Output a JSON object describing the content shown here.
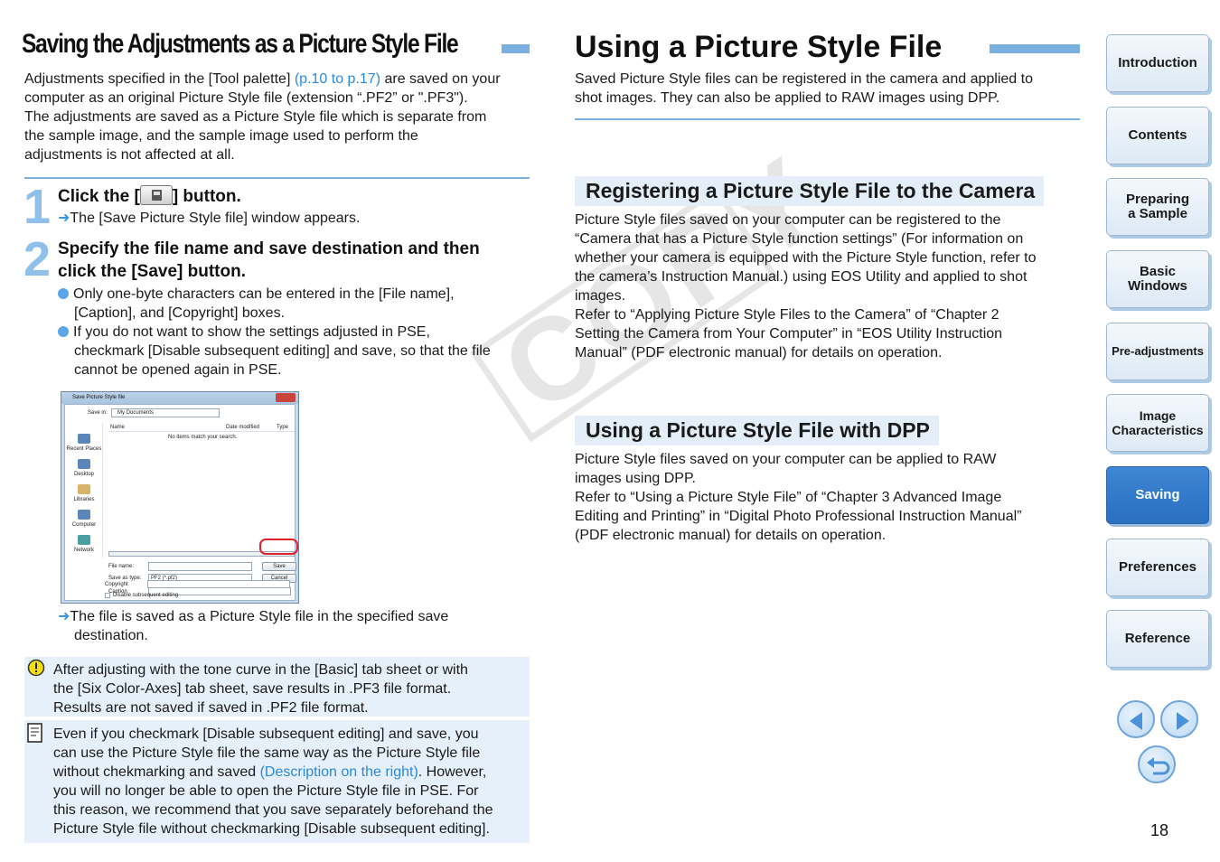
{
  "left": {
    "title": "Saving the Adjustments as a Picture Style File",
    "intro_1a": "Adjustments specified in the [Tool palette] ",
    "intro_link": "(p.10 to p.17)",
    "intro_1b": " are saved on your",
    "intro_2": "computer as an original Picture Style file (extension “.PF2” or \".PF3\").",
    "intro_3": "The adjustments are saved as a Picture Style file which is separate from",
    "intro_4": "the sample image, and the sample image used to perform the",
    "intro_5": "adjustments is not affected at all.",
    "step1": {
      "number": "1",
      "title_a": "Click the [",
      "title_b": "] button.",
      "result": "The [Save Picture Style file] window appears."
    },
    "step2": {
      "number": "2",
      "title_1": "Specify the file name and save destination and then",
      "title_2": "click the [Save] button.",
      "bullet1_1": "Only one-byte characters can be entered in the [File name],",
      "bullet1_2": "[Caption], and [Copyright] boxes.",
      "bullet2_1": "If you do not want to show the settings adjusted in PSE,",
      "bullet2_2": "checkmark [Disable subsequent editing] and save, so that the file",
      "bullet2_3": "cannot be opened again in PSE.",
      "result_1": "The file is saved as a Picture Style file in the specified save",
      "result_2": "destination."
    },
    "dialog": {
      "title": "Save Picture Style file",
      "save_in_label": "Save in:",
      "save_in_value": "My Documents",
      "col_name": "Name",
      "col_date": "Date modified",
      "col_type": "Type",
      "empty_msg": "No items match your search.",
      "places": [
        "Recent Places",
        "Desktop",
        "Libraries",
        "Computer",
        "Network"
      ],
      "file_name_label": "File name:",
      "save_as_type_label": "Save as type:",
      "save_as_type_value": "PF2 (*.pf2)",
      "save_button": "Save",
      "cancel_button": "Cancel",
      "caption_label": "Caption",
      "copyright_label": "Copyright",
      "disable_label": "Disable subsequent editing"
    },
    "caution": {
      "line1": "After adjusting with the tone curve in the [Basic] tab sheet or with",
      "line2": "the [Six Color-Axes] tab sheet, save results in .PF3 file format.",
      "line3": "Results are not saved if saved in .PF2 file format."
    },
    "memo": {
      "line1": "Even if you checkmark [Disable subsequent editing] and save, you",
      "line2": "can use the Picture Style file the same way as the Picture Style file",
      "line3a": "without chekmarking and saved ",
      "line3_link": "(Description on the right)",
      "line3b": ". However,",
      "line4": "you will no longer be able to open the Picture Style file in PSE. For",
      "line5": "this reason, we recommend that you save separately beforehand the",
      "line6": "Picture Style file without checkmarking [Disable subsequent editing]."
    }
  },
  "right": {
    "title": "Using a Picture Style File",
    "intro_1": "Saved Picture Style files can be registered in the camera and applied to",
    "intro_2": "shot images. They can also be applied to RAW images using DPP.",
    "section1": {
      "heading": "Registering a Picture Style File to the Camera",
      "lines": [
        "Picture Style files saved on your computer can be registered to the",
        "“Camera that has a Picture Style function settings” (For information on",
        "whether your camera is equipped with the Picture Style function, refer to",
        "the camera’s Instruction Manual.) using EOS Utility and applied to shot",
        "images.",
        "Refer to “Applying Picture Style Files to the Camera” of “Chapter 2",
        "Setting the Camera from Your Computer” in “EOS Utility Instruction",
        "Manual” (PDF electronic manual) for details on operation."
      ]
    },
    "section2": {
      "heading": "Using a Picture Style File with DPP",
      "lines": [
        "Picture Style files saved on your computer can be applied to RAW",
        "images using DPP.",
        "Refer to “Using a Picture Style File” of “Chapter 3 Advanced Image",
        "Editing and Printing” in “Digital Photo Professional Instruction Manual”",
        "(PDF electronic manual) for details on operation."
      ]
    }
  },
  "watermark": "COPY",
  "nav": {
    "introduction": "Introduction",
    "contents": "Contents",
    "preparing_1": "Preparing",
    "preparing_2": "a Sample",
    "basic_1": "Basic",
    "basic_2": "Windows",
    "pre_adjustments": "Pre-adjustments",
    "image_1": "Image",
    "image_2": "Characteristics",
    "saving": "Saving",
    "preferences": "Preferences",
    "reference": "Reference",
    "active": "Saving"
  },
  "icons": {
    "prev": "previous-page-icon",
    "next": "next-page-icon",
    "back": "return-icon",
    "caution": "caution-icon",
    "memo": "memo-icon"
  },
  "colors": {
    "accent": "#7ab0e0",
    "link": "#2a8ad8",
    "nav_active": "#2a6fc0",
    "note_bg": "#e6f0fa"
  },
  "page_number": "18"
}
